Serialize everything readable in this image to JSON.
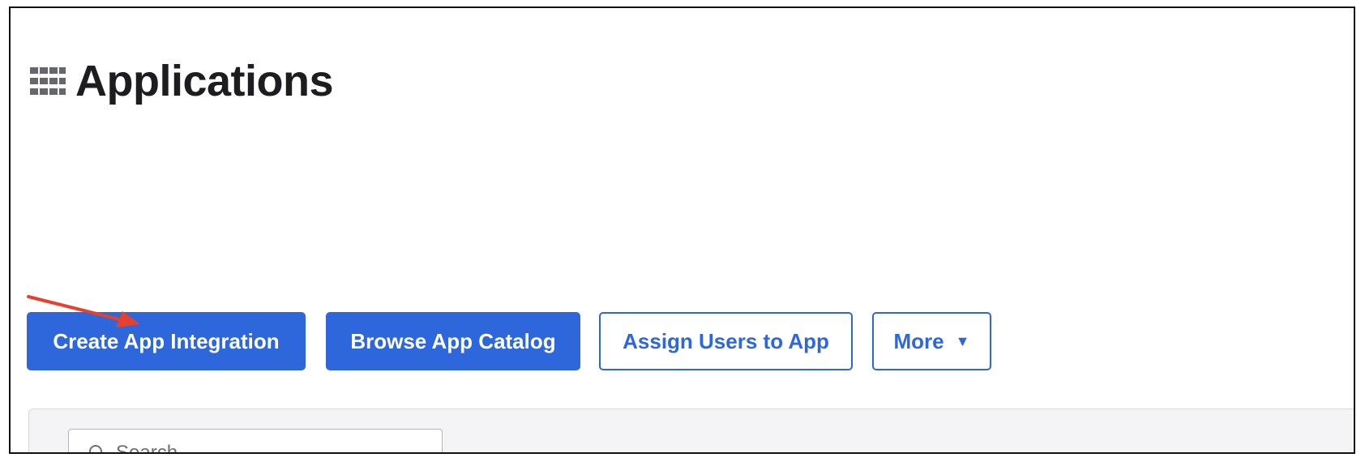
{
  "header": {
    "title": "Applications",
    "icon": "apps-grid-icon"
  },
  "toolbar": {
    "create_label": "Create App Integration",
    "browse_label": "Browse App Catalog",
    "assign_label": "Assign Users to App",
    "more_label": "More",
    "more_caret": "▼"
  },
  "search": {
    "placeholder": "Search",
    "value": ""
  },
  "annotation": {
    "type": "arrow",
    "color": "#e5412d"
  },
  "colors": {
    "accent": "#2e67dc",
    "title_text": "#1d1d21",
    "panel_bg": "#f4f4f6"
  }
}
